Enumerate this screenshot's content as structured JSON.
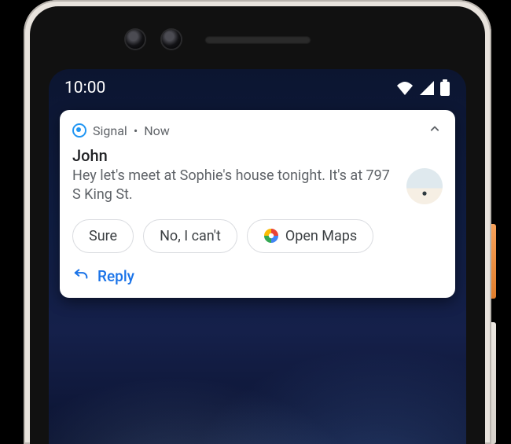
{
  "status_bar": {
    "time": "10:00",
    "icons": {
      "wifi": "wifi-icon",
      "signal": "cellular-icon",
      "battery": "battery-icon"
    }
  },
  "notification": {
    "app_name": "Signal",
    "timestamp": "Now",
    "separator": "•",
    "sender": "John",
    "message": "Hey let's meet at Sophie's house tonight. It's at 797 S King St.",
    "suggestions": {
      "chip1": "Sure",
      "chip2": "No, I can't",
      "chip3": "Open Maps"
    },
    "reply_label": "Reply"
  }
}
